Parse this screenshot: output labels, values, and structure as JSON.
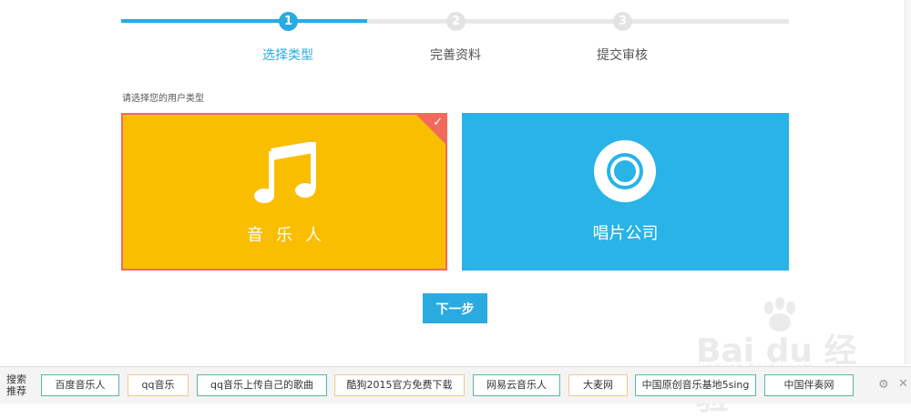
{
  "steps": [
    {
      "number": "1",
      "label": "选择类型"
    },
    {
      "number": "2",
      "label": "完善资料"
    },
    {
      "number": "3",
      "label": "提交审核"
    }
  ],
  "prompt": "请选择您的用户类型",
  "cards": {
    "music": {
      "label": "音乐人",
      "selected_mark": "✓"
    },
    "record": {
      "label": "唱片公司"
    }
  },
  "next_button": "下一步",
  "bottom_bar": {
    "label": "搜索推荐",
    "chips": [
      "百度音乐人",
      "qq音乐",
      "qq音乐上传自己的歌曲",
      "酷狗2015官方免费下载",
      "网易云音乐人",
      "大麦网",
      "中国原创音乐基地5sing",
      "中国伴奏网"
    ]
  },
  "watermark": {
    "text": "Bai du 经验",
    "url": "jingyan.baidu.com"
  },
  "colors": {
    "accent": "#29abe2",
    "music_card": "#f9be00",
    "record_card": "#29b3e6",
    "selected_border": "#f26a5c"
  }
}
